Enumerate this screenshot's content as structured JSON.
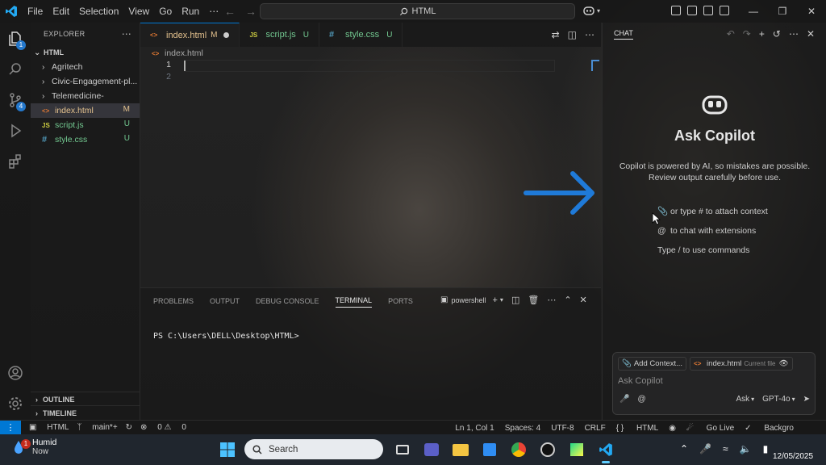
{
  "titlebar": {
    "menu": [
      "File",
      "Edit",
      "Selection",
      "View",
      "Go",
      "Run",
      "⋯"
    ],
    "search": "HTML"
  },
  "activity": {
    "explorer_badge": "1",
    "scm_badge": "4"
  },
  "explorer": {
    "title": "EXPLORER",
    "root": "HTML",
    "folders": [
      "Agritech",
      "Civic-Engagement-pl...",
      "Telemedicine-"
    ],
    "files": [
      {
        "name": "index.html",
        "status": "M",
        "lang": "<>"
      },
      {
        "name": "script.js",
        "status": "U",
        "lang": "JS"
      },
      {
        "name": "style.css",
        "status": "U",
        "lang": "#"
      }
    ],
    "outline": "OUTLINE",
    "timeline": "TIMELINE"
  },
  "tabs": [
    {
      "name": "index.html",
      "status": "M",
      "lang": "<>"
    },
    {
      "name": "script.js",
      "status": "U",
      "lang": "JS"
    },
    {
      "name": "style.css",
      "status": "U",
      "lang": "#"
    }
  ],
  "editor": {
    "breadcrumb": "index.html",
    "lines": [
      "1",
      "2"
    ]
  },
  "panel": {
    "tabs": [
      "PROBLEMS",
      "OUTPUT",
      "DEBUG CONSOLE",
      "TERMINAL",
      "PORTS"
    ],
    "active_tab": "TERMINAL",
    "shell": "powershell",
    "prompt": "PS C:\\Users\\DELL\\Desktop\\HTML>"
  },
  "chat": {
    "header": "CHAT",
    "title": "Ask Copilot",
    "description": "Copilot is powered by AI, so mistakes are possible. Review output carefully before use.",
    "hints": [
      "or type # to attach context",
      "to chat with extensions",
      "Type / to use commands"
    ],
    "add_context": "Add Context...",
    "current_file": "index.html",
    "current_file_tag": "Current file",
    "placeholder": "Ask Copilot",
    "mode": "Ask",
    "model": "GPT-4o"
  },
  "statusbar": {
    "project": "HTML",
    "branch": "main*+",
    "problems": "0",
    "warnings": "0",
    "position": "Ln 1, Col 1",
    "spaces": "Spaces: 4",
    "encoding": "UTF-8",
    "eol": "CRLF",
    "language": "HTML",
    "golive": "Go Live",
    "background": "Backgro"
  },
  "taskbar": {
    "weather_name": "Humid",
    "weather_sub": "Now",
    "weather_badge": "1",
    "search": "Search",
    "date": "12/05/2025"
  },
  "colors": {
    "accent": "#0078d4",
    "modified": "#e2c08d",
    "untracked": "#73c991",
    "annotation_arrow": "#1f7ad8"
  }
}
